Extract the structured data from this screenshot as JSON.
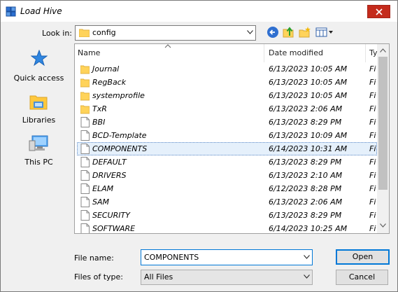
{
  "window": {
    "title": "Load Hive"
  },
  "toolbar": {
    "look_in_label": "Look in:",
    "look_in_value": "config"
  },
  "places": [
    {
      "label": "Quick access",
      "icon": "star-icon"
    },
    {
      "label": "Libraries",
      "icon": "libraries-icon"
    },
    {
      "label": "This PC",
      "icon": "computer-icon"
    }
  ],
  "columns": {
    "name": "Name",
    "date": "Date modified",
    "type": "Ty"
  },
  "files": [
    {
      "name": "Journal",
      "date": "6/13/2023 10:05 AM",
      "type": "Fi",
      "kind": "folder"
    },
    {
      "name": "RegBack",
      "date": "6/13/2023 10:05 AM",
      "type": "Fi",
      "kind": "folder"
    },
    {
      "name": "systemprofile",
      "date": "6/13/2023 10:05 AM",
      "type": "Fi",
      "kind": "folder"
    },
    {
      "name": "TxR",
      "date": "6/13/2023 2:06 AM",
      "type": "Fi",
      "kind": "folder"
    },
    {
      "name": "BBI",
      "date": "6/13/2023 8:29 PM",
      "type": "Fi",
      "kind": "file"
    },
    {
      "name": "BCD-Template",
      "date": "6/13/2023 10:09 AM",
      "type": "Fi",
      "kind": "file"
    },
    {
      "name": "COMPONENTS",
      "date": "6/14/2023 10:31 AM",
      "type": "Fi",
      "kind": "file",
      "selected": true
    },
    {
      "name": "DEFAULT",
      "date": "6/13/2023 8:29 PM",
      "type": "Fi",
      "kind": "file"
    },
    {
      "name": "DRIVERS",
      "date": "6/13/2023 2:10 AM",
      "type": "Fi",
      "kind": "file"
    },
    {
      "name": "ELAM",
      "date": "6/12/2023 8:28 PM",
      "type": "Fi",
      "kind": "file"
    },
    {
      "name": "SAM",
      "date": "6/13/2023 2:06 AM",
      "type": "Fi",
      "kind": "file"
    },
    {
      "name": "SECURITY",
      "date": "6/13/2023 8:29 PM",
      "type": "Fi",
      "kind": "file"
    },
    {
      "name": "SOFTWARE",
      "date": "6/14/2023 10:25 AM",
      "type": "Fi",
      "kind": "file"
    }
  ],
  "footer": {
    "file_name_label": "File name:",
    "file_name_value": "COMPONENTS",
    "file_type_label": "Files of type:",
    "file_type_value": "All Files",
    "open_label": "Open",
    "cancel_label": "Cancel"
  },
  "colors": {
    "accent": "#0078d7",
    "close": "#c42b1c",
    "folder": "#ffd35a"
  }
}
